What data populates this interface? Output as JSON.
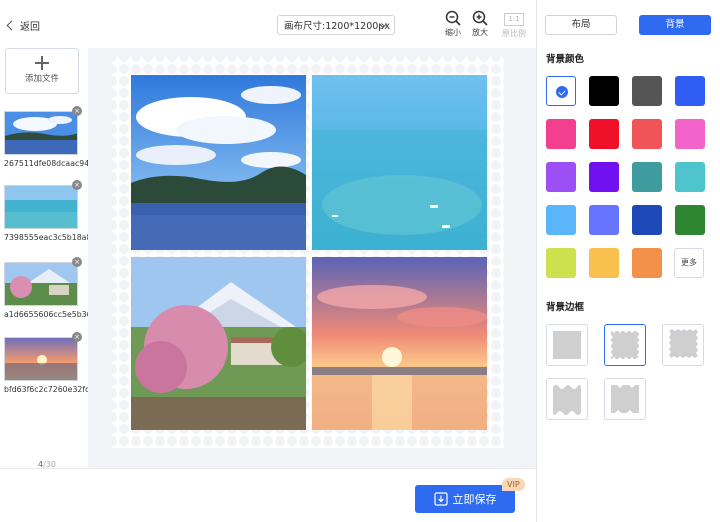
{
  "header": {
    "back_label": "返回",
    "canvas_size": "画布尺寸:1200*1200px",
    "zoom_out_label": "缩小",
    "zoom_in_label": "放大",
    "ratio_box": "1:1",
    "original_ratio_label": "原比例"
  },
  "files": {
    "add_label": "添加文件",
    "items": [
      {
        "name": "267511dfe08dcaac94..."
      },
      {
        "name": "7398555eac3c5b18a8..."
      },
      {
        "name": "a1d6655606cc5e5b36..."
      },
      {
        "name": "bfd63f6c2c7260e32fd..."
      }
    ],
    "count_current": "4",
    "count_total": "/30"
  },
  "footer": {
    "save_label": "立即保存",
    "vip_badge": "VIP"
  },
  "side": {
    "tabs": [
      {
        "label": "布局",
        "active": false
      },
      {
        "label": "背景",
        "active": true
      }
    ],
    "bg_color_title": "背景颜色",
    "colors": [
      "#ffffff",
      "#000000",
      "#555555",
      "#2f5cf2",
      "#f2408f",
      "#ee1127",
      "#f05456",
      "#f264c9",
      "#9b4ff5",
      "#7111f0",
      "#3f9c9e",
      "#4ec5cc",
      "#5bb5fa",
      "#6774ff",
      "#1d48b8",
      "#2f8632",
      "#cde14e",
      "#f7c04f",
      "#f3914a"
    ],
    "more_label": "更多",
    "bg_border_title": "背景边框"
  },
  "colors": {
    "accent": "#2f6bf1"
  }
}
